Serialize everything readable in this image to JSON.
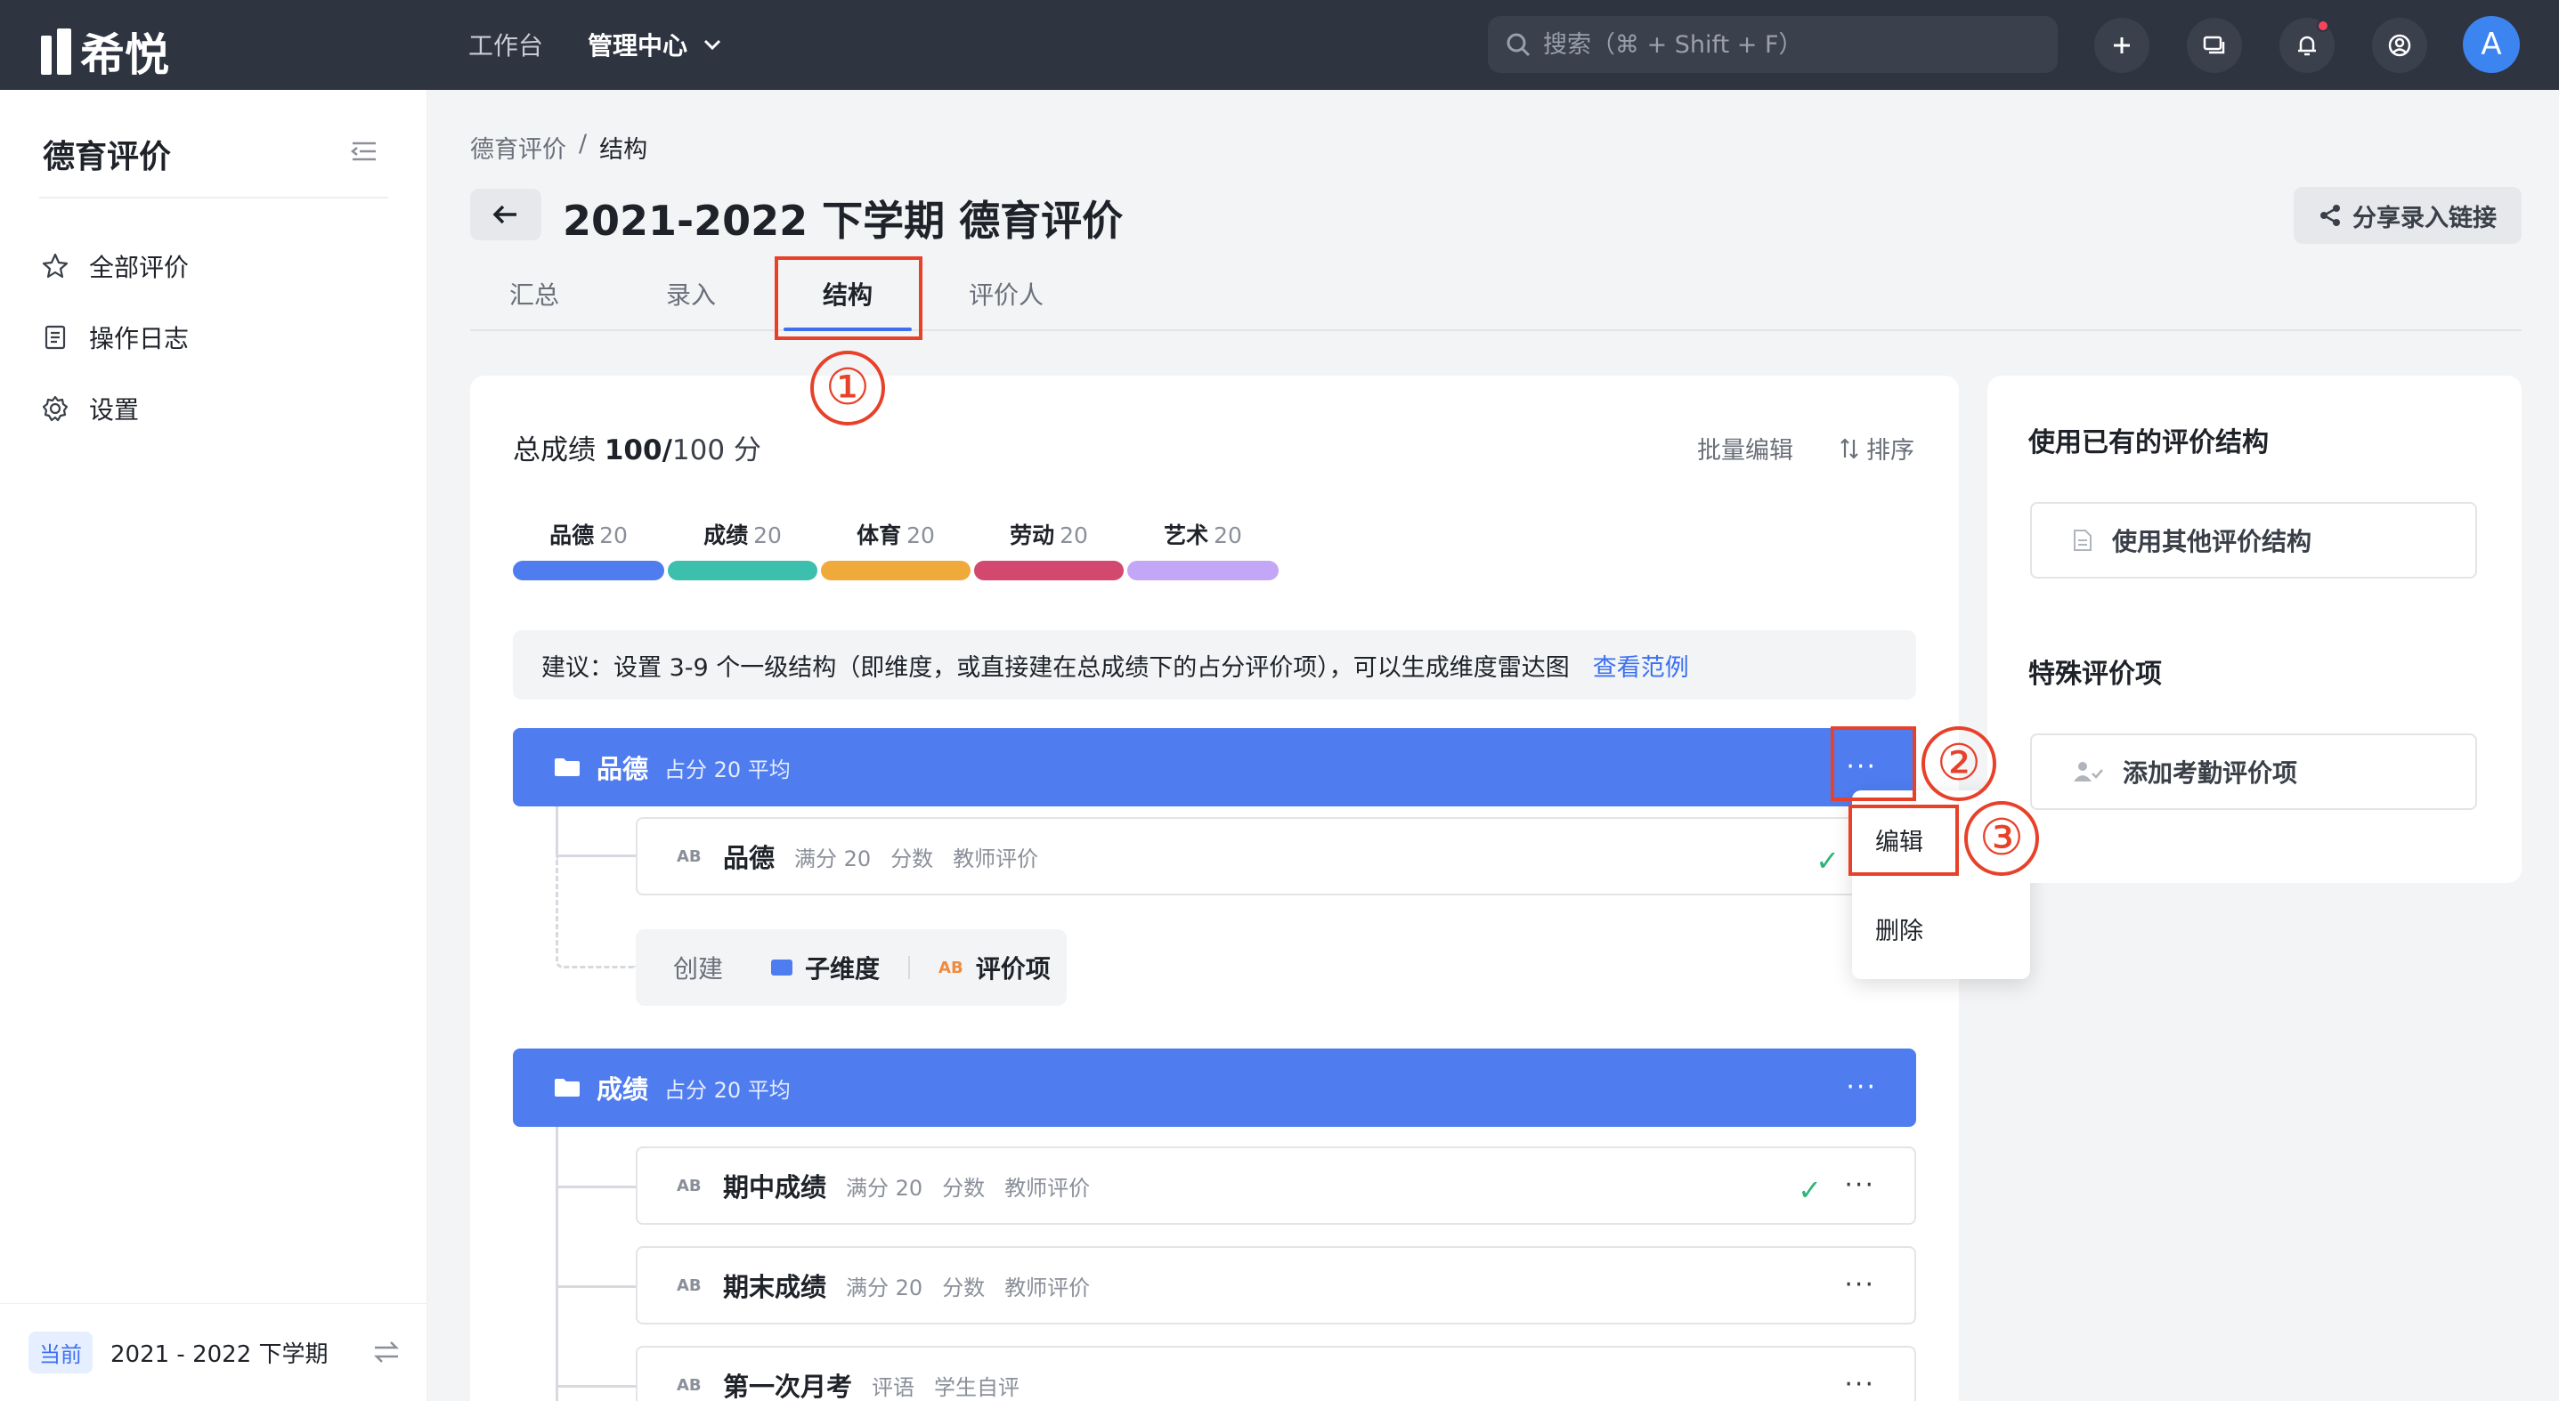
{
  "topbar": {
    "logo_text": "希悦",
    "nav": [
      {
        "label": "工作台"
      },
      {
        "label": "管理中心"
      }
    ],
    "search_placeholder": "搜索（⌘ + Shift + F）",
    "avatar_letter": "A",
    "colors": {
      "bg": "#2f3441",
      "avatar": "#3c84f0",
      "notif_dot": "#f5455c"
    }
  },
  "sidebar": {
    "title": "德育评价",
    "items": [
      {
        "label": "全部评价",
        "icon": "star-icon"
      },
      {
        "label": "操作日志",
        "icon": "document-icon"
      },
      {
        "label": "设置",
        "icon": "gear-icon"
      }
    ],
    "footer": {
      "tag": "当前",
      "term": "2021 - 2022 下学期"
    }
  },
  "header": {
    "breadcrumb": [
      "德育评价",
      "/",
      "结构"
    ],
    "title": "2021-2022 下学期 德育评价",
    "share_label": "分享录入链接"
  },
  "tabs": [
    {
      "label": "汇总"
    },
    {
      "label": "录入"
    },
    {
      "label": "结构",
      "active": true
    },
    {
      "label": "评价人"
    }
  ],
  "annotations": [
    "①",
    "②",
    "③"
  ],
  "structure": {
    "total_label": "总成绩",
    "total_value": "100/",
    "total_max": "100 分",
    "actions": {
      "batch_edit": "批量编辑",
      "sort": "排序"
    },
    "segments": [
      {
        "name": "品德",
        "score": "20",
        "color": "#4f7df0"
      },
      {
        "name": "成绩",
        "score": "20",
        "color": "#3dbfae"
      },
      {
        "name": "体育",
        "score": "20",
        "color": "#f0aa3c"
      },
      {
        "name": "劳动",
        "score": "20",
        "color": "#d2486e"
      },
      {
        "name": "艺术",
        "score": "20",
        "color": "#c3a6f5"
      }
    ],
    "tip": {
      "text": "建议：设置 3-9 个一级结构（即维度，或直接建在总成绩下的占分评价项），可以生成维度雷达图",
      "link": "查看范例"
    },
    "groups": [
      {
        "name": "品德",
        "meta": "占分 20 平均",
        "items": [
          {
            "name": "品德",
            "full": "满分 20",
            "type": "分数",
            "evaluator": "教师评价",
            "checked": true
          }
        ],
        "create": {
          "label": "创建",
          "sub_dim": "子维度",
          "item": "评价项"
        }
      },
      {
        "name": "成绩",
        "meta": "占分 20 平均",
        "items": [
          {
            "name": "期中成绩",
            "full": "满分 20",
            "type": "分数",
            "evaluator": "教师评价",
            "checked": true
          },
          {
            "name": "期末成绩",
            "full": "满分 20",
            "type": "分数",
            "evaluator": "教师评价",
            "checked": false
          },
          {
            "name": "第一次月考",
            "full": "",
            "type": "评语",
            "evaluator": "学生自评",
            "checked": false
          }
        ]
      }
    ],
    "more_label": "···",
    "dropdown": [
      {
        "label": "编辑"
      },
      {
        "label": "删除"
      }
    ]
  },
  "right_panel": {
    "existing_title": "使用已有的评价结构",
    "existing_btn": "使用其他评价结构",
    "special_title": "特殊评价项",
    "special_btn": "添加考勤评价项"
  },
  "check_mark": "✓",
  "annotation_color": "#e8412a"
}
